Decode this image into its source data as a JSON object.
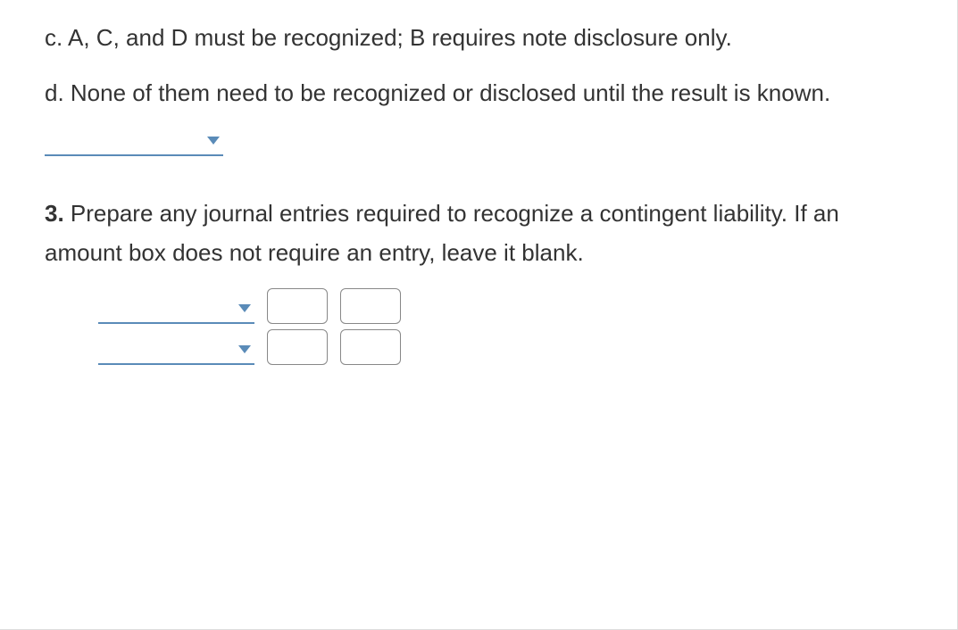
{
  "options": {
    "c": "c. A, C, and D must be recognized; B requires note disclosure only.",
    "d": "d. None of them need to be recognized or disclosed until the result is known."
  },
  "question3": {
    "number": "3.",
    "text": " Prepare any journal entries required to recognize a contingent liability. If an amount box does not require an entry, leave it blank."
  }
}
